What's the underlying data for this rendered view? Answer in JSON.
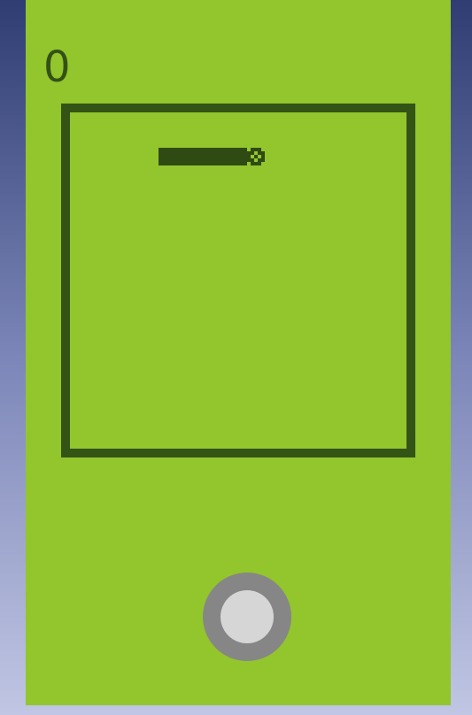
{
  "game": {
    "score": "0"
  },
  "colors": {
    "screen": "#93c52d",
    "ink": "#345416",
    "joystick_ring": "#868686",
    "joystick_knob": "#d6d6d6"
  },
  "icons": {
    "snake_head": "pixel-snake-head-icon"
  }
}
